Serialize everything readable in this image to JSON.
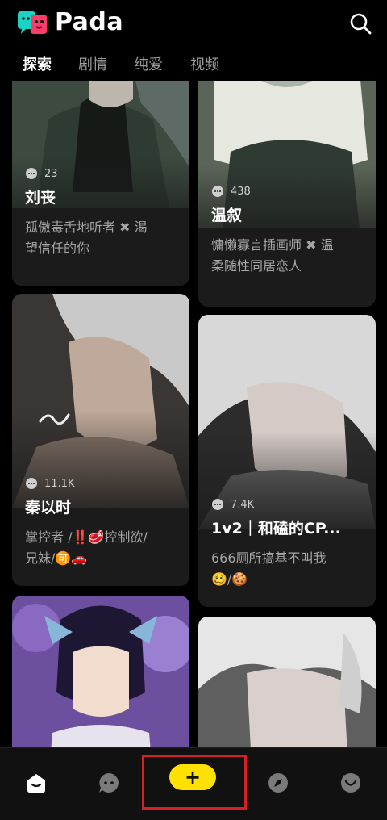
{
  "app": {
    "brand": "Pada",
    "icon": "pada-logo"
  },
  "header": {
    "search_icon": "search-icon"
  },
  "tabs": [
    {
      "label": "探索",
      "active": true
    },
    {
      "label": "剧情",
      "active": false
    },
    {
      "label": "纯爱",
      "active": false
    },
    {
      "label": "视频",
      "active": false
    }
  ],
  "cards": [
    {
      "count": "23",
      "title": "刘丧",
      "desc1": "孤傲毒舌地听者 ✖ 渴",
      "desc2": "望信任的你"
    },
    {
      "count": "438",
      "title": "温叙",
      "desc1": "慵懒寡言插画师 ✖ 温",
      "desc2": "柔随性同居恋人"
    },
    {
      "count": "11.1K",
      "title": "秦以时",
      "desc1": "掌控者 /‼️🥩控制欲/",
      "desc2": "兄妹/🉑🚗"
    },
    {
      "count": "7.4K",
      "title": "1v2｜和磕的CP...",
      "desc1": "666厕所搞基不叫我",
      "desc2": "🥴/🍪"
    },
    {
      "count": "",
      "title": "",
      "desc1": "",
      "desc2": ""
    },
    {
      "count": "",
      "title": "",
      "desc1": "",
      "desc2": ""
    }
  ],
  "bottom_nav": {
    "items": [
      "home-icon",
      "chat-icon",
      "create-button",
      "discover-icon",
      "profile-icon"
    ],
    "create_label": "+"
  },
  "colors": {
    "accent": "#ffe100",
    "highlight": "#d61f26",
    "background": "#000000",
    "card": "#1b1b1b"
  }
}
